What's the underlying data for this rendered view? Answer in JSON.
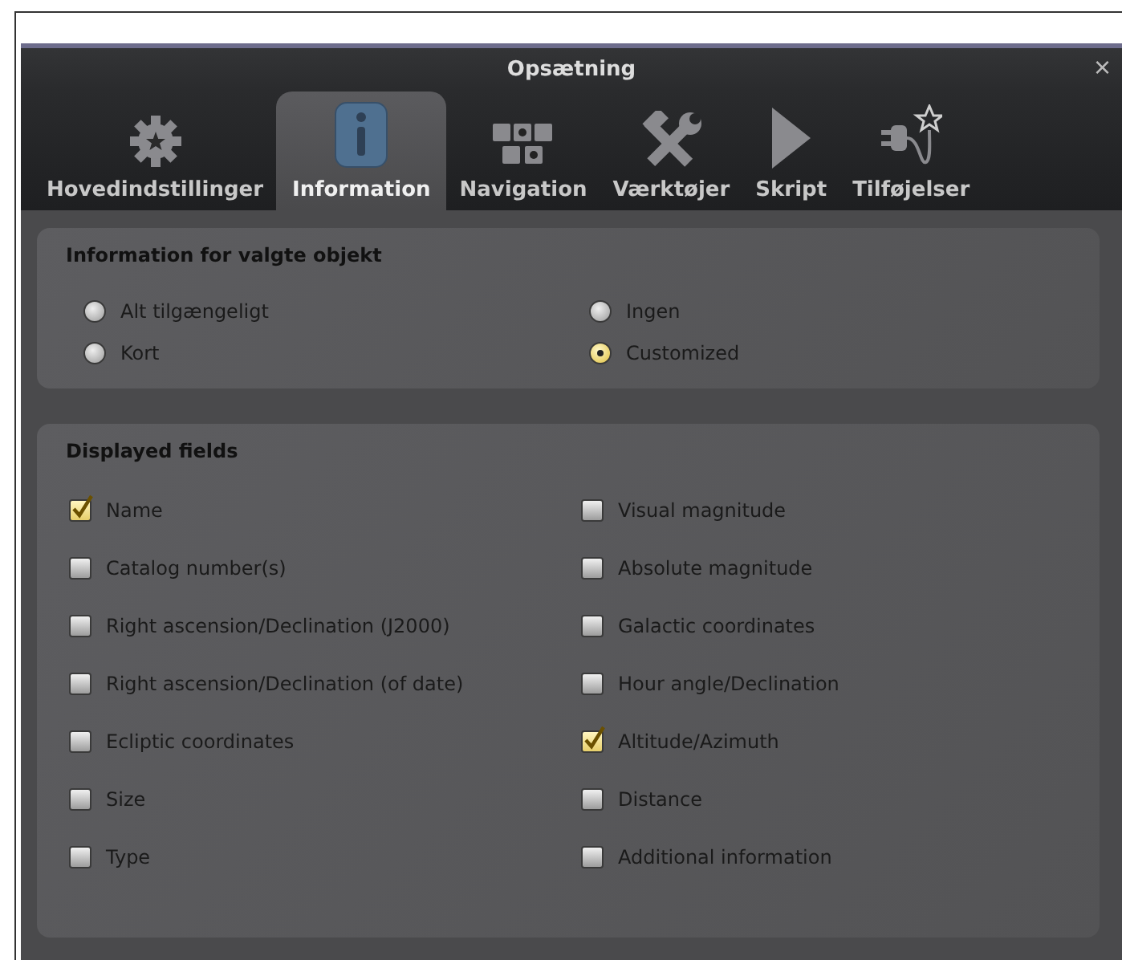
{
  "window": {
    "title": "Opsætning",
    "close": "×"
  },
  "tabs": [
    {
      "label": "Hovedindstillinger",
      "kind": "gear",
      "selected": false
    },
    {
      "label": "Information",
      "kind": "info",
      "selected": true
    },
    {
      "label": "Navigation",
      "kind": "grid",
      "selected": false
    },
    {
      "label": "Værktøjer",
      "kind": "tools",
      "selected": false
    },
    {
      "label": "Skript",
      "kind": "play",
      "selected": false
    },
    {
      "label": "Tilføjelser",
      "kind": "plug",
      "selected": false
    }
  ],
  "info_group": {
    "title": "Information for valgte objekt",
    "options": [
      {
        "label": "Alt tilgængeligt",
        "selected": false
      },
      {
        "label": "Ingen",
        "selected": false
      },
      {
        "label": "Kort",
        "selected": false
      },
      {
        "label": "Customized",
        "selected": true
      }
    ]
  },
  "fields_group": {
    "title": "Displayed fields",
    "fields": [
      {
        "label": "Name",
        "checked": true
      },
      {
        "label": "Visual magnitude",
        "checked": false
      },
      {
        "label": "Catalog number(s)",
        "checked": false
      },
      {
        "label": "Absolute magnitude",
        "checked": false
      },
      {
        "label": "Right ascension/Declination (J2000)",
        "checked": false
      },
      {
        "label": "Galactic coordinates",
        "checked": false
      },
      {
        "label": "Right ascension/Declination (of date)",
        "checked": false
      },
      {
        "label": "Hour angle/Declination",
        "checked": false
      },
      {
        "label": "Ecliptic coordinates",
        "checked": false
      },
      {
        "label": "Altitude/Azimuth",
        "checked": true
      },
      {
        "label": "Size",
        "checked": false
      },
      {
        "label": "Distance",
        "checked": false
      },
      {
        "label": "Type",
        "checked": false
      },
      {
        "label": "Additional information",
        "checked": false
      }
    ]
  }
}
